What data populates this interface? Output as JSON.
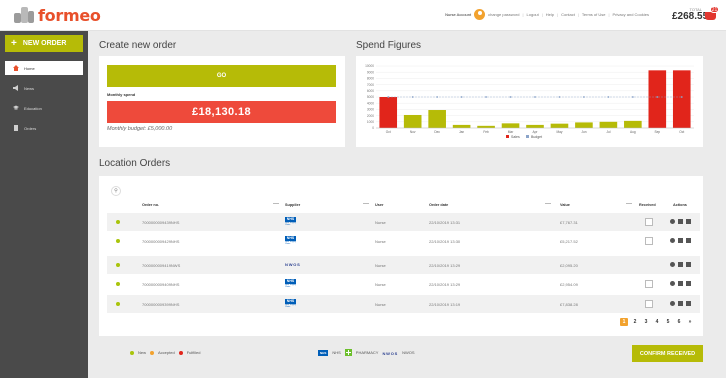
{
  "brand": {
    "name": "formeo"
  },
  "topnav": {
    "account": "Nurse Account",
    "links": [
      "change password",
      "Logout",
      "Help",
      "Contact",
      "Terms of Use",
      "Privacy and Cookies"
    ],
    "total_label": "TOTAL",
    "total_value": "£268.55",
    "basket_count": "21"
  },
  "sidebar": {
    "new_order": "NEW ORDER",
    "items": [
      {
        "label": "Home",
        "icon": "home-icon",
        "active": true
      },
      {
        "label": "News",
        "icon": "megaphone-icon",
        "active": false
      },
      {
        "label": "Education",
        "icon": "graduation-cap-icon",
        "active": false
      },
      {
        "label": "Orders",
        "icon": "document-icon",
        "active": false
      }
    ]
  },
  "create_order": {
    "title": "Create new order",
    "go_label": "GO",
    "monthly_spend_label": "Monthly spend",
    "monthly_spend_value": "£18,130.18",
    "monthly_budget": "Monthly budget: £5,000.00"
  },
  "spend": {
    "title": "Spend Figures"
  },
  "chart_data": {
    "type": "bar",
    "categories": [
      "Oct",
      "Nov",
      "Dec",
      "Jan",
      "Feb",
      "Mar",
      "Apr",
      "May",
      "Jun",
      "Jul",
      "Aug",
      "Sep",
      "Oct"
    ],
    "series": [
      {
        "name": "Sales",
        "values": [
          5000,
          2100,
          2900,
          500,
          350,
          750,
          500,
          700,
          900,
          1000,
          1150,
          9300,
          9300
        ]
      },
      {
        "name": "Budget",
        "values": [
          5000,
          5000,
          5000,
          5000,
          5000,
          5000,
          5000,
          5000,
          5000,
          5000,
          5000,
          5000,
          5000
        ]
      }
    ],
    "highlight_over_budget_color": "#e1251b",
    "under_budget_color": "#b6bb07",
    "budget_color": "#8ba4c9",
    "y_ticks": [
      0,
      1000,
      2000,
      3000,
      4000,
      5000,
      6000,
      7000,
      8000,
      9000,
      10000
    ],
    "ylim": [
      0,
      10000
    ],
    "legend_position": "bottom"
  },
  "orders": {
    "title": "Location Orders",
    "columns": [
      "Order no.",
      "Supplier",
      "User",
      "Order date",
      "Value",
      "Received",
      "Actions"
    ],
    "rows": [
      {
        "order_no": "7000000009439NHS",
        "supplier": "NHS Supply Chain",
        "user": "Nurse",
        "date": "22/10/2019 13:31",
        "value": "£7,767.31",
        "received": false
      },
      {
        "order_no": "7000000009429NHS",
        "supplier": "NHS Supply Chain",
        "user": "Nurse",
        "date": "22/10/2019 13:30",
        "value": "£5,217.52",
        "received": false
      },
      {
        "order_no": "7000000009419NWS",
        "supplier": "NWOS",
        "user": "Nurse",
        "date": "22/10/2019 13:29",
        "value": "£2,095.20",
        "received": false
      },
      {
        "order_no": "7000000009409NHS",
        "supplier": "NHS Supply Chain",
        "user": "Nurse",
        "date": "22/10/2019 13:29",
        "value": "£2,954.09",
        "received": false
      },
      {
        "order_no": "7000000009399NHS",
        "supplier": "NHS Supply Chain",
        "user": "Nurse",
        "date": "22/10/2019 13:19",
        "value": "£7,838.28",
        "received": false
      }
    ],
    "pages": [
      "1",
      "2",
      "3",
      "4",
      "5",
      "6",
      "»"
    ],
    "current_page": "1"
  },
  "legend": {
    "status": [
      {
        "label": "New",
        "color": "#a9c40b"
      },
      {
        "label": "Accepted",
        "color": "#f2a22e"
      },
      {
        "label": "Fulfilled",
        "color": "#e1251b"
      }
    ],
    "suppliers": [
      "NHS",
      "PHARMACY",
      "NWOS"
    ],
    "nhs_badge": "NHS",
    "nwos_badge": "NWOS"
  },
  "confirm_label": "CONFIRM RECEIVED"
}
